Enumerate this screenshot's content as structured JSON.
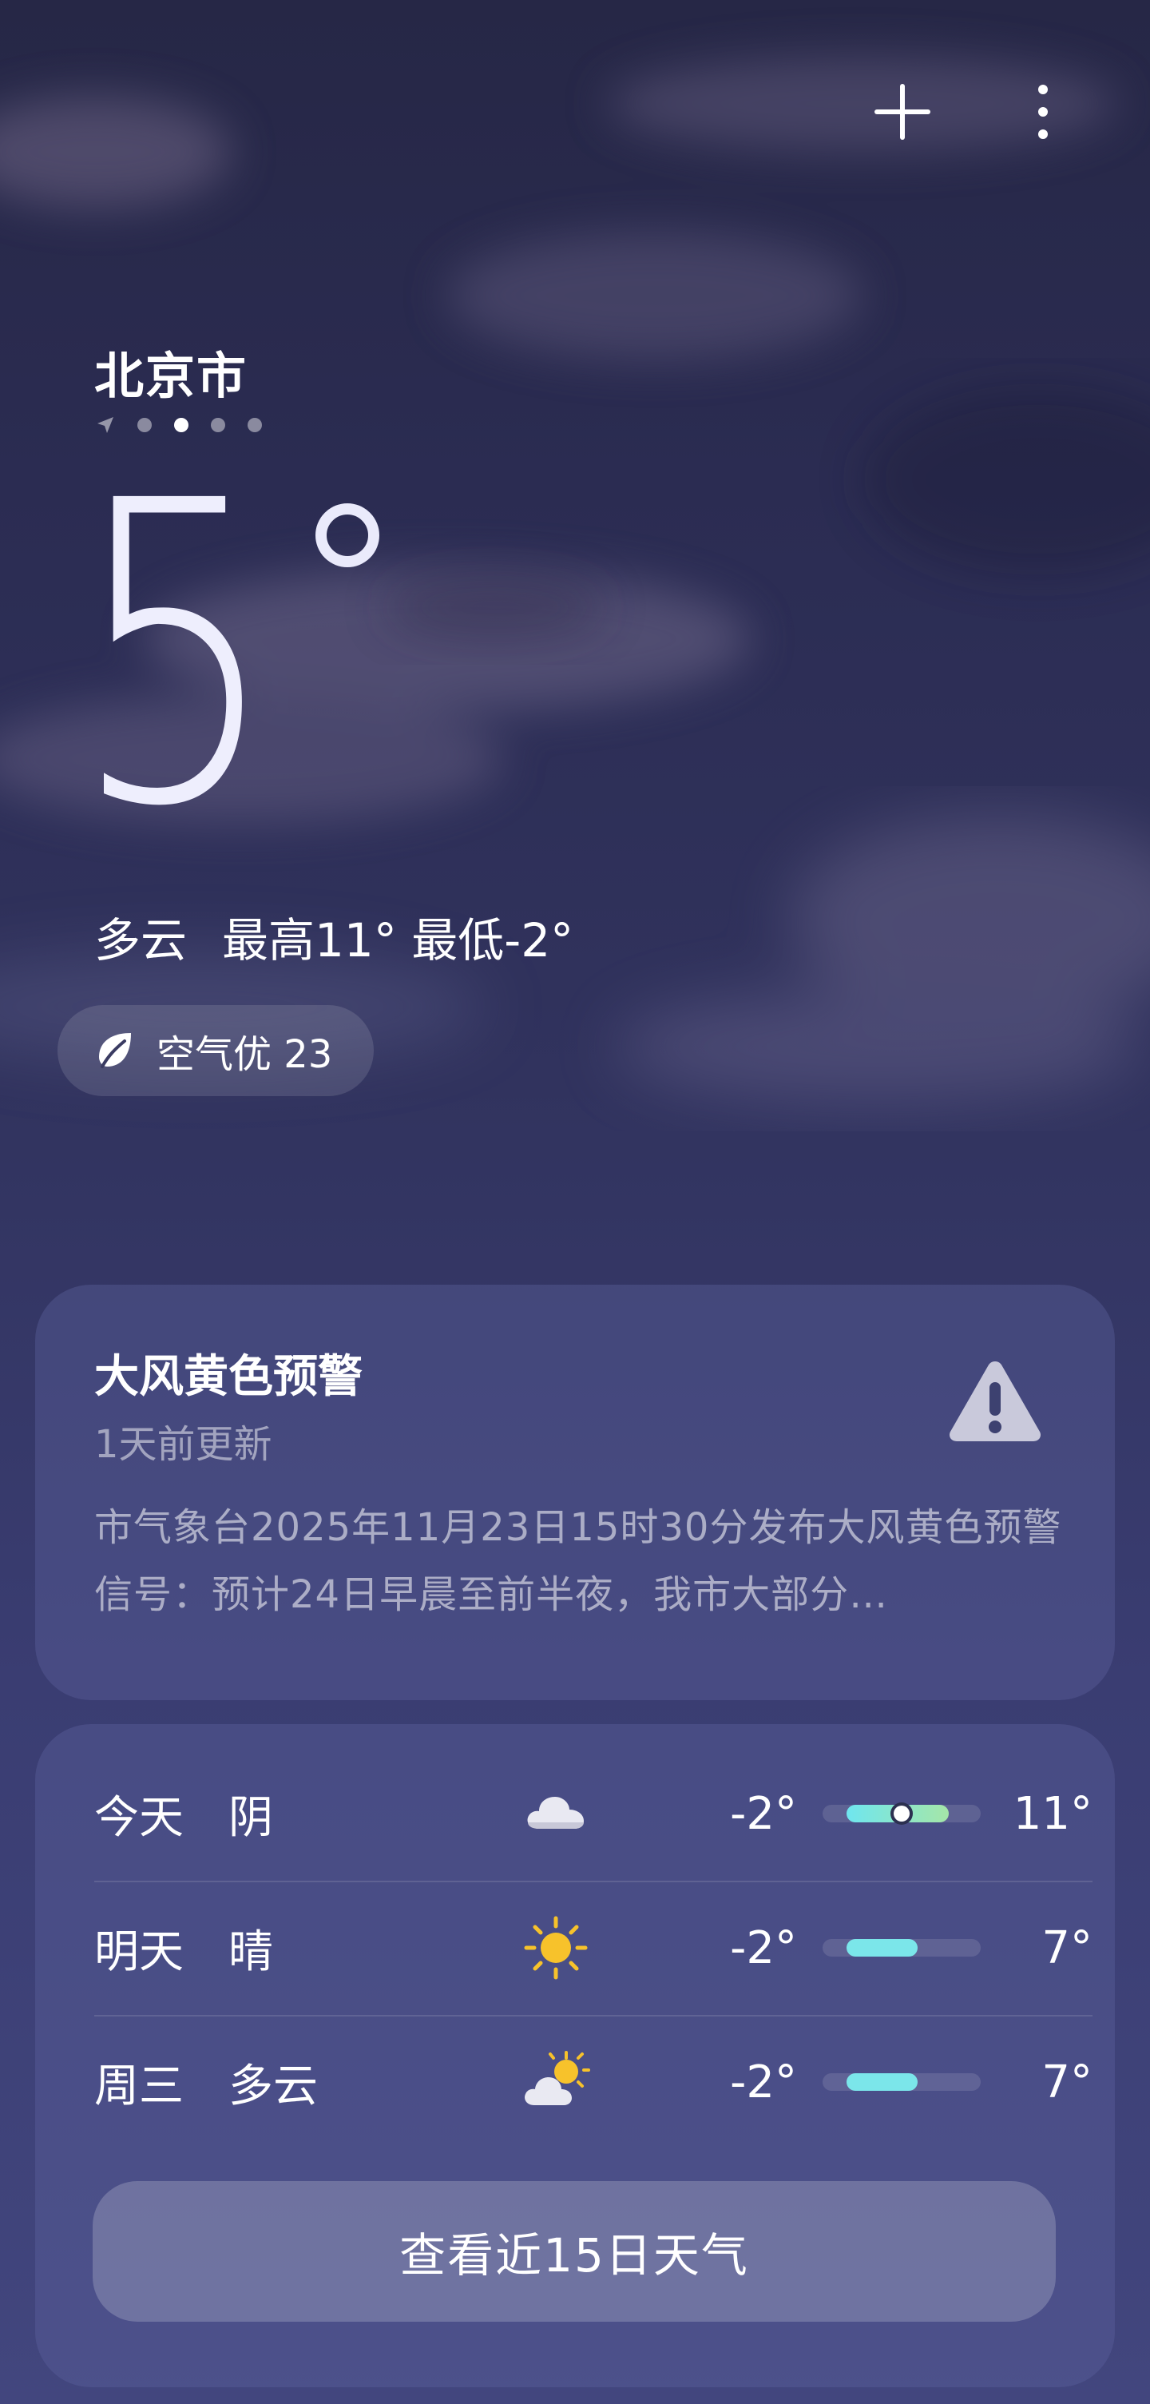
{
  "header": {
    "add_icon": "plus-icon",
    "menu_icon": "more-vertical-icon"
  },
  "location": {
    "city": "北京市",
    "page_count": 4,
    "active_page": 2,
    "first_is_location": true
  },
  "current": {
    "temperature": "5",
    "condition": "多云",
    "high_label": "最高11°",
    "low_label": "最低-2°"
  },
  "air_quality": {
    "icon": "leaf-icon",
    "label": "空气优 23"
  },
  "alert": {
    "title": "大风黄色预警",
    "updated": "1天前更新",
    "icon": "warning-triangle-icon",
    "body": "市气象台2025年11月23日15时30分发布大风黄色预警信号：预计24日早晨至前半夜，我市大部分…"
  },
  "forecast": [
    {
      "day": "今天",
      "cond": "阴",
      "icon": "cloud-icon",
      "low": "-2°",
      "high": "11°",
      "range": [
        0.15,
        0.8
      ],
      "current_marker": 0.5,
      "color_from": "#6fe6ef",
      "color_to": "#a5e6a8"
    },
    {
      "day": "明天",
      "cond": "晴",
      "icon": "sun-icon",
      "low": "-2°",
      "high": "7°",
      "range": [
        0.15,
        0.6
      ],
      "color_from": "#7be6ea",
      "color_to": "#7be6ea"
    },
    {
      "day": "周三",
      "cond": "多云",
      "icon": "partly-cloudy-icon",
      "low": "-2°",
      "high": "7°",
      "range": [
        0.15,
        0.6
      ],
      "color_from": "#7be6ea",
      "color_to": "#7be6ea"
    }
  ],
  "cta_label": "查看近15日天气",
  "colors": {
    "accent_warning": "#c9c9db",
    "sun": "#f7c22b",
    "cloud": "#e9e9f2"
  }
}
